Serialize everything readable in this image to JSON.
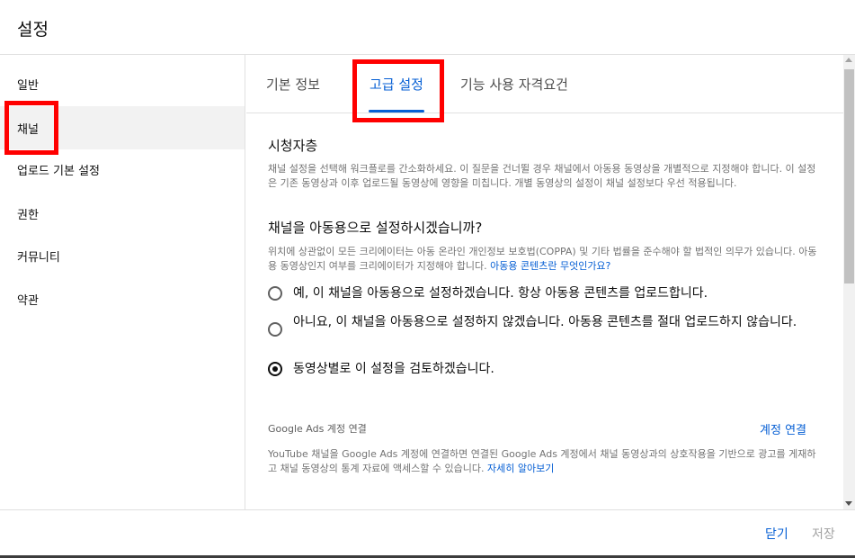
{
  "dialog": {
    "title": "설정"
  },
  "sidebar": {
    "items": [
      {
        "label": "일반"
      },
      {
        "label": "채널"
      },
      {
        "label": "업로드 기본 설정"
      },
      {
        "label": "권한"
      },
      {
        "label": "커뮤니티"
      },
      {
        "label": "약관"
      }
    ],
    "active_index": 1
  },
  "tabs": [
    {
      "label": "기본 정보"
    },
    {
      "label": "고급 설정"
    },
    {
      "label": "기능 사용 자격요건"
    }
  ],
  "audience": {
    "heading": "시청자층",
    "description": "채널 설정을 선택해 워크플로를 간소화하세요. 이 질문을 건너뛸 경우 채널에서 아동용 동영상을 개별적으로 지정해야 합니다. 이 설정은 기존 동영상과 이후 업로드될 동영상에 영향을 미칩니다. 개별 동영상의 설정이 채널 설정보다 우선 적용됩니다.",
    "question": "채널을 아동용으로 설정하시겠습니까?",
    "question_desc": "위치에 상관없이 모든 크리에이터는 아동 온라인 개인정보 보호법(COPPA) 및 기타 법률을 준수해야 할 법적인 의무가 있습니다. 아동용 동영상인지 여부를 크리에이터가 지정해야 합니다.",
    "question_link": "아동용 콘텐츠란 무엇인가요?",
    "options": [
      {
        "label": "예, 이 채널을 아동용으로 설정하겠습니다. 항상 아동용 콘텐츠를 업로드합니다."
      },
      {
        "label": "아니요, 이 채널을 아동용으로 설정하지 않겠습니다. 아동용 콘텐츠를 절대 업로드하지 않습니다."
      },
      {
        "label": "동영상별로 이 설정을 검토하겠습니다."
      }
    ],
    "selected_option": 2
  },
  "google_ads": {
    "label": "Google Ads 계정 연결",
    "connect_label": "계정 연결",
    "description": "YouTube 채널을 Google Ads 계정에 연결하면 연결된 Google Ads 계정에서 채널 동영상과의 상호작용을 기반으로 광고를 게재하고 채널 동영상의 통계 자료에 액세스할 수 있습니다.",
    "learn_more": "자세히 알아보기"
  },
  "footer": {
    "close_label": "닫기",
    "save_label": "저장"
  },
  "colors": {
    "accent": "#065fd4",
    "highlight": "#ff0000"
  }
}
